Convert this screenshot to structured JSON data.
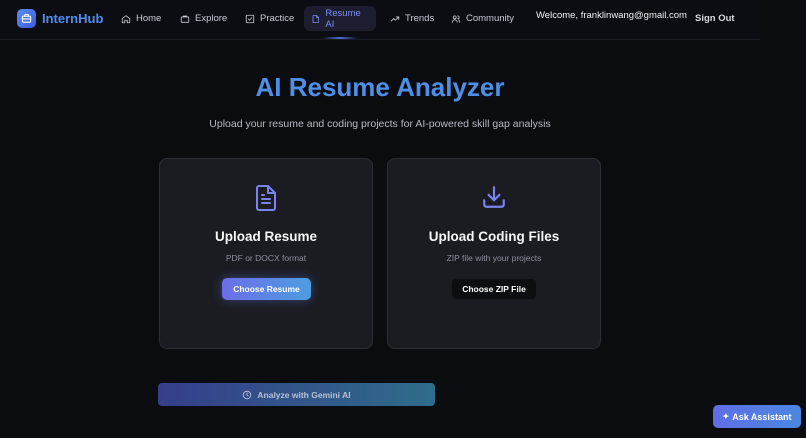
{
  "brand": {
    "name": "InternHub"
  },
  "nav": {
    "items": [
      {
        "label": "Home",
        "icon": "home-icon",
        "active": false
      },
      {
        "label": "Explore",
        "icon": "briefcase-icon",
        "active": false
      },
      {
        "label": "Practice",
        "icon": "checkbox-icon",
        "active": false
      },
      {
        "label": "Resume AI",
        "icon": "file-icon",
        "active": true
      },
      {
        "label": "Trends",
        "icon": "trending-up-icon",
        "active": false
      },
      {
        "label": "Community",
        "icon": "users-icon",
        "active": false
      }
    ],
    "welcome": "Welcome, franklinwang@gmail.com",
    "sign_out": "Sign Out"
  },
  "hero": {
    "title": "AI Resume Analyzer",
    "subtitle": "Upload your resume and coding projects for AI-powered skill gap analysis"
  },
  "cards": [
    {
      "title": "Upload Resume",
      "description": "PDF or DOCX format",
      "button": "Choose Resume",
      "icon": "document-icon"
    },
    {
      "title": "Upload Coding Files",
      "description": "ZIP file with your projects",
      "button": "Choose ZIP File",
      "icon": "download-icon"
    }
  ],
  "analyze_button": "Analyze with Gemini AI",
  "assistant_button": "Ask Assistant",
  "colors": {
    "accent": "#4f8ee6",
    "active_nav_bg": "#1c1e30",
    "card_bg": "#1b1c22",
    "background": "#0b0c10"
  }
}
